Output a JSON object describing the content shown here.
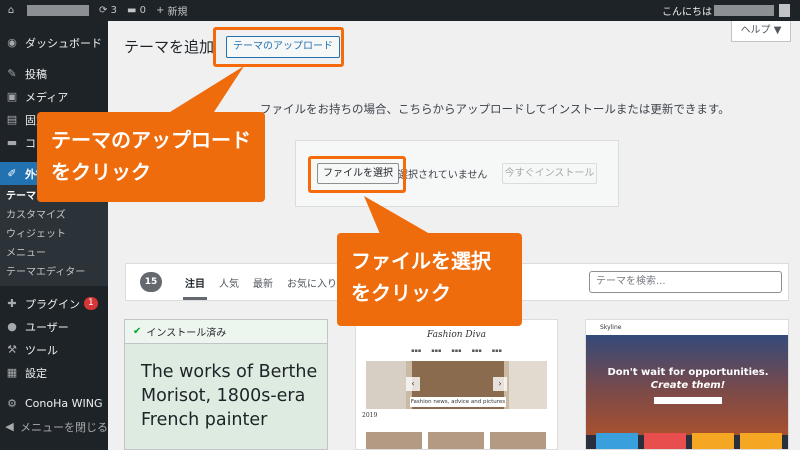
{
  "adminbar": {
    "updates_count": "3",
    "comments_count": "0",
    "new_label": "新規",
    "greeting": "こんにちは"
  },
  "sidebar": {
    "dashboard": "ダッシュボード",
    "posts": "投稿",
    "media": "メディア",
    "pages": "固定",
    "comments": "コン",
    "appearance": "外観",
    "submenu": [
      "テーマ",
      "カスタマイズ",
      "ウィジェット",
      "メニュー",
      "テーマエディター"
    ],
    "plugins": "プラグイン",
    "plugins_badge": "1",
    "users": "ユーザー",
    "tools": "ツール",
    "settings": "設定",
    "conoha": "ConoHa WING",
    "collapse": "メニューを閉じる"
  },
  "main": {
    "title": "テーマを追加",
    "upload_button": "テーマのアップロード",
    "help": "ヘルプ ▼",
    "description": "ファイルをお持ちの場合、こちらからアップロードしてインストールまたは更新できます。",
    "file_button": "ファイルを選択",
    "no_file": "選択されていません",
    "install_button": "今すぐインストール"
  },
  "callouts": {
    "upload": [
      "テーマのアップロード",
      "をクリック"
    ],
    "file": [
      "ファイルを選択",
      "をクリック"
    ]
  },
  "filter": {
    "count": "15",
    "tabs": [
      "注目",
      "人気",
      "最新",
      "お気に入り"
    ],
    "search_placeholder": "テーマを検索..."
  },
  "themes": {
    "installed_label": "インストール済み",
    "card1_text": "The works of Berthe Morisot, 1800s-era French painter",
    "card2_title": "Fashion Diva",
    "card2_caption": "Fashion news, advice and pictures",
    "card2_year": "2019",
    "card3_brand": "Skyline",
    "card3_line1": "Don't wait for opportunities.",
    "card3_line2": "Create them!"
  },
  "colors": {
    "accent": "#2271b1",
    "callout": "#ef6c0c",
    "highlight": "#f56b0b",
    "sidebar_bg": "#1d2327"
  }
}
